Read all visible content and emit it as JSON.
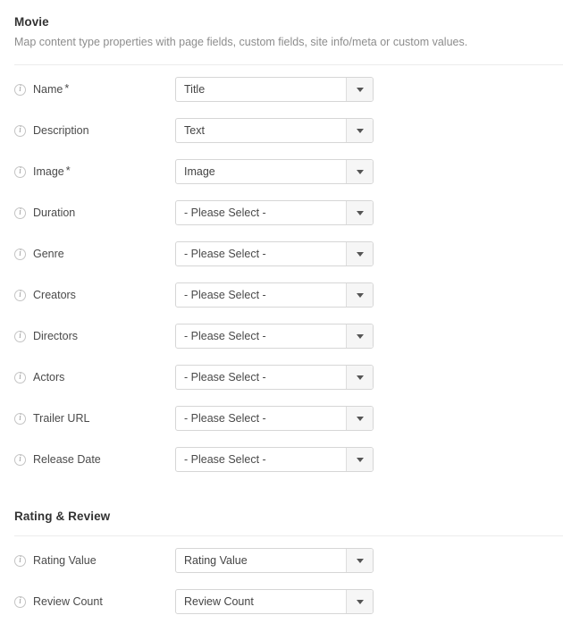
{
  "sections": [
    {
      "title": "Movie",
      "subtitle": "Map content type properties with page fields, custom fields, site info/meta or custom values.",
      "fields": [
        {
          "label": "Name",
          "required": true,
          "value": "Title",
          "icon": "info-icon"
        },
        {
          "label": "Description",
          "required": false,
          "value": "Text",
          "icon": "info-icon"
        },
        {
          "label": "Image",
          "required": true,
          "value": "Image",
          "icon": "info-icon"
        },
        {
          "label": "Duration",
          "required": false,
          "value": "- Please Select -",
          "icon": "info-icon"
        },
        {
          "label": "Genre",
          "required": false,
          "value": "- Please Select -",
          "icon": "info-icon"
        },
        {
          "label": "Creators",
          "required": false,
          "value": "- Please Select -",
          "icon": "info-icon"
        },
        {
          "label": "Directors",
          "required": false,
          "value": "- Please Select -",
          "icon": "info-icon"
        },
        {
          "label": "Actors",
          "required": false,
          "value": "- Please Select -",
          "icon": "info-icon"
        },
        {
          "label": "Trailer URL",
          "required": false,
          "value": "- Please Select -",
          "icon": "info-icon"
        },
        {
          "label": "Release Date",
          "required": false,
          "value": "- Please Select -",
          "icon": "info-icon"
        }
      ]
    },
    {
      "title": "Rating & Review",
      "subtitle": "",
      "fields": [
        {
          "label": "Rating Value",
          "required": false,
          "value": "Rating Value",
          "icon": "info-icon"
        },
        {
          "label": "Review Count",
          "required": false,
          "value": "Review Count",
          "icon": "info-icon"
        }
      ]
    }
  ],
  "glyphs": {
    "info": "i",
    "required_marker": "*",
    "caret": "chevron-down-icon"
  },
  "colors": {
    "background": "#ffffff",
    "title_text": "#333333",
    "subtitle_text": "#8d8d8d",
    "label_text": "#4a4a4a",
    "value_text": "#444444",
    "border": "#d6d6d6",
    "divider": "#ececec",
    "button_face": "#f6f6f6",
    "caret": "#555555",
    "icon_border": "#c4c4c4"
  },
  "placeholder_option": "- Please Select -"
}
